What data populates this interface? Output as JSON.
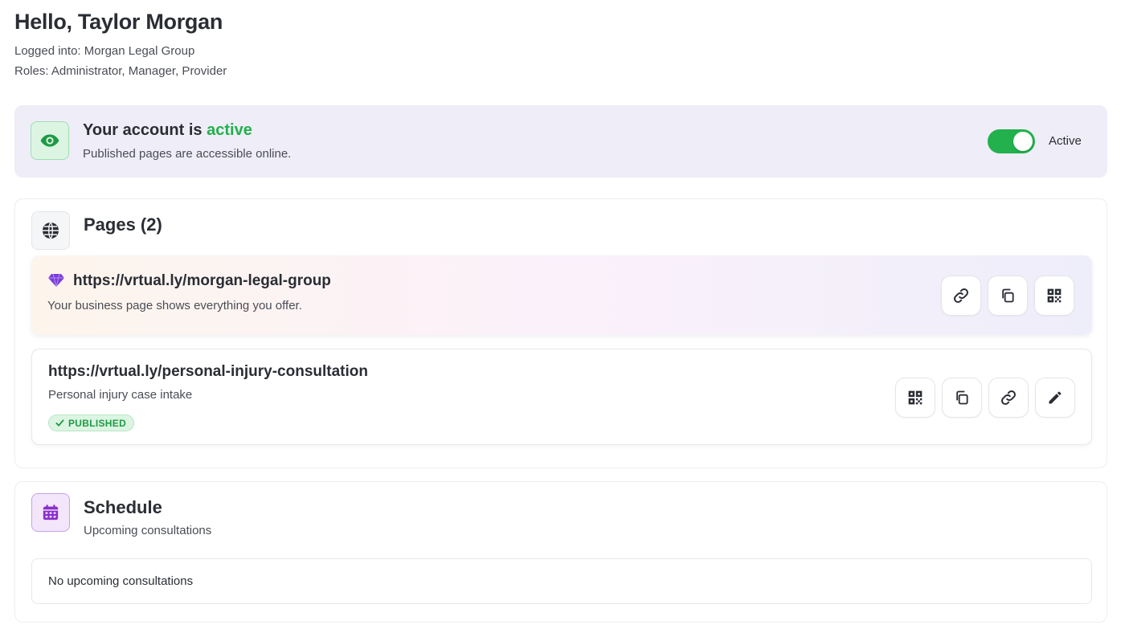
{
  "header": {
    "greeting": "Hello, Taylor Morgan",
    "logged_into": "Logged into: Morgan Legal Group",
    "roles": "Roles: Administrator, Manager, Provider"
  },
  "account_status": {
    "title_prefix": "Your account is ",
    "status_word": "active",
    "subtitle": "Published pages are accessible online.",
    "toggle_on": true,
    "toggle_label": "Active",
    "icon": "eye-icon",
    "accent_color": "#22b14c"
  },
  "pages": {
    "title": "Pages (2)",
    "icon": "globe-icon",
    "items": [
      {
        "url": "https://vrtual.ly/morgan-legal-group",
        "description": "Your business page shows everything you offer.",
        "icon": "gem-icon",
        "actions": [
          "link-icon",
          "copy-icon",
          "qr-code-icon"
        ]
      },
      {
        "url": "https://vrtual.ly/personal-injury-consultation",
        "description": "Personal injury case intake",
        "badge": "PUBLISHED",
        "actions": [
          "qr-code-icon",
          "copy-icon",
          "link-icon",
          "pencil-icon"
        ]
      }
    ]
  },
  "schedule": {
    "title": "Schedule",
    "subtitle": "Upcoming consultations",
    "icon": "calendar-icon",
    "accent_color": "#8a2fc9",
    "empty_text": "No upcoming consultations"
  }
}
